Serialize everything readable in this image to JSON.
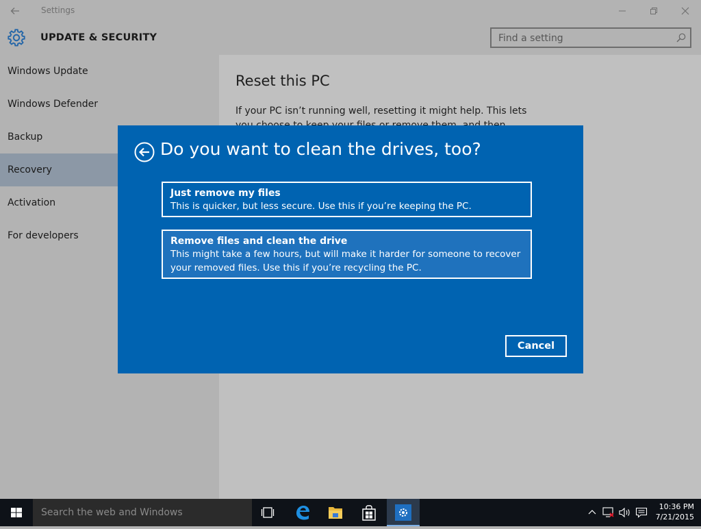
{
  "window": {
    "title": "Settings",
    "back_icon": "arrow-left-icon",
    "minimize_icon": "minimize-icon",
    "maximize_icon": "restore-icon",
    "close_icon": "close-icon"
  },
  "header": {
    "icon": "gear-icon",
    "title": "UPDATE & SECURITY",
    "search": {
      "placeholder": "Find a setting",
      "value": "",
      "icon": "search-icon"
    }
  },
  "sidebar": {
    "items": [
      {
        "label": "Windows Update",
        "selected": false
      },
      {
        "label": "Windows Defender",
        "selected": false
      },
      {
        "label": "Backup",
        "selected": false
      },
      {
        "label": "Recovery",
        "selected": true
      },
      {
        "label": "Activation",
        "selected": false
      },
      {
        "label": "For developers",
        "selected": false
      }
    ]
  },
  "main": {
    "title": "Reset this PC",
    "description": "If your PC isn’t running well, resetting it might help. This lets you choose to keep your files or remove them, and then reinstalls"
  },
  "dialog": {
    "back_icon": "circle-arrow-left-icon",
    "title": "Do you want to clean the drives, too?",
    "options": [
      {
        "title": "Just remove my files",
        "description": "This is quicker, but less secure. Use this if you’re keeping the PC."
      },
      {
        "title": "Remove files and clean the drive",
        "description": "This might take a few hours, but will make it harder for someone to recover your removed files. Use this if you’re recycling the PC."
      }
    ],
    "cancel_label": "Cancel"
  },
  "taskbar": {
    "start_icon": "windows-logo-icon",
    "search_placeholder": "Search the web and Windows",
    "apps": [
      "task-view-icon",
      "edge-icon",
      "file-explorer-icon",
      "store-icon",
      "settings-icon"
    ],
    "tray": {
      "chevron_icon": "chevron-up-icon",
      "network_icon": "network-disconnected-icon",
      "volume_icon": "volume-icon",
      "notifications_icon": "action-center-icon",
      "time": "10:36 PM",
      "date": "7/21/2015"
    }
  },
  "colors": {
    "dialog_bg": "#0063b1",
    "selected_option_bg": "#1f72bd",
    "sidebar_selected": "#8c98a6",
    "taskbar_bg": "#0e1218"
  }
}
